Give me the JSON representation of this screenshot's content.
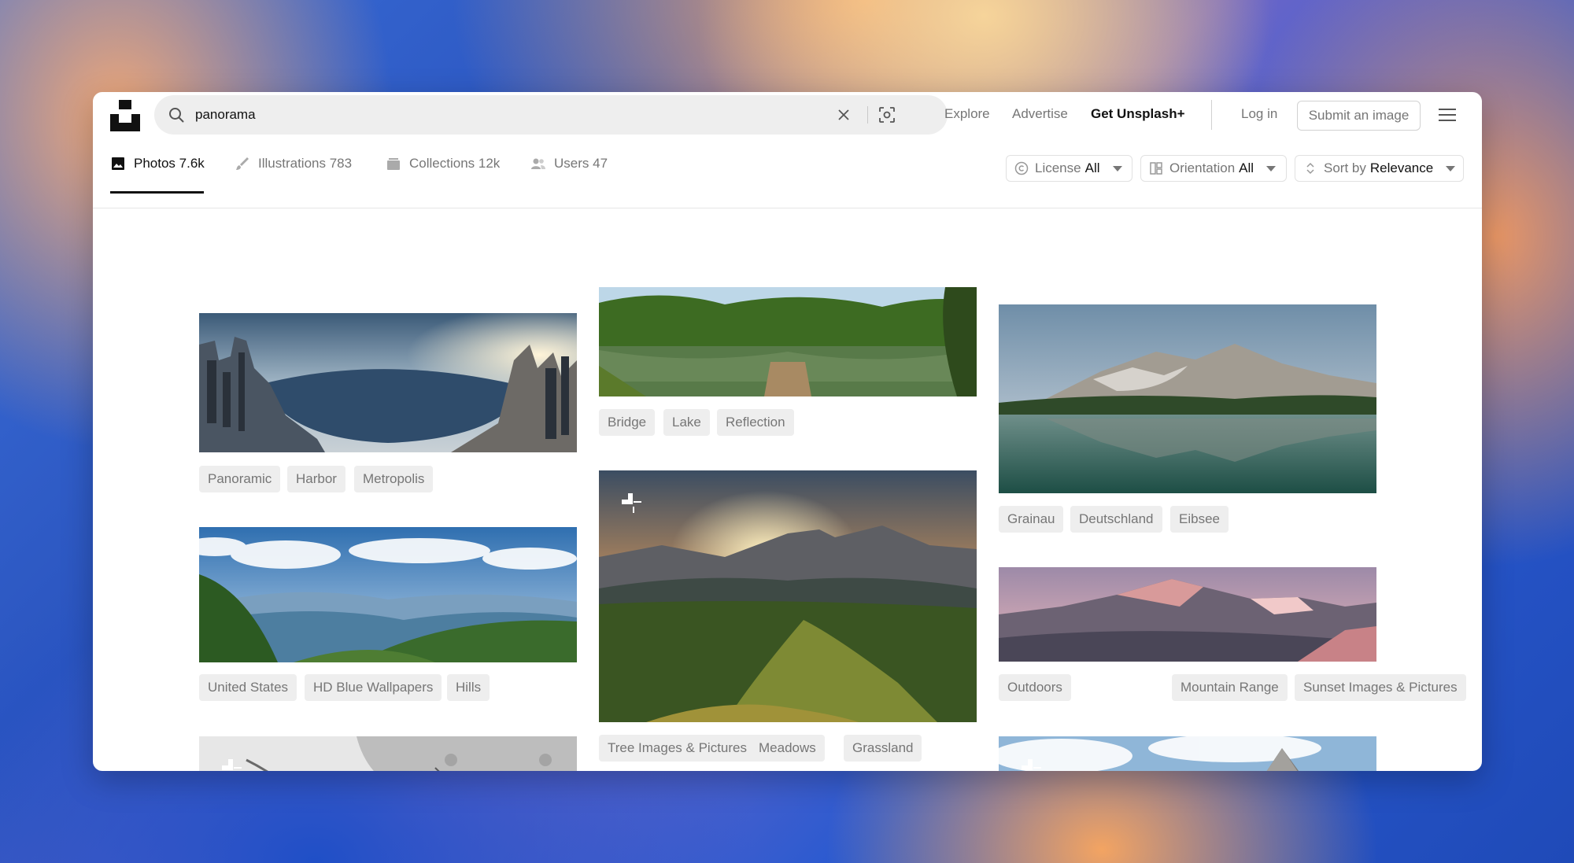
{
  "search": {
    "value": "panorama",
    "placeholder": "Search photos and illustrations"
  },
  "nav": {
    "explore": "Explore",
    "advertise": "Advertise",
    "get_plus": "Get Unsplash+",
    "login": "Log in",
    "submit": "Submit an image"
  },
  "tabs": [
    {
      "label": "Photos 7.6k",
      "icon": "photo-icon",
      "active": true
    },
    {
      "label": "Illustrations 783",
      "icon": "brush-icon"
    },
    {
      "label": "Collections 12k",
      "icon": "collections-icon"
    },
    {
      "label": "Users 47",
      "icon": "users-icon"
    }
  ],
  "filters": {
    "license": {
      "label": "License",
      "value": "All"
    },
    "orientation": {
      "label": "Orientation",
      "value": "All"
    },
    "sort": {
      "label": "Sort by",
      "value": "Relevance"
    }
  },
  "photos": {
    "hongkong": {
      "tags": [
        "Panoramic",
        "Harbor",
        "Metropolis"
      ]
    },
    "hills": {
      "tags": [
        "United States",
        "HD Blue Wallpapers",
        "Hills"
      ]
    },
    "lake": {
      "tags": [
        "Bridge",
        "Lake",
        "Reflection"
      ]
    },
    "sunset_ridge": {
      "tags": [
        "Tree Images & Pictures",
        "Meadows",
        "Grassland"
      ]
    },
    "eibsee": {
      "tags": [
        "Grainau",
        "Deutschland",
        "Eibsee"
      ]
    },
    "range": {
      "tags": [
        "Outdoors",
        "Mountain Range",
        "Sunset Images & Pictures"
      ]
    }
  },
  "colors": {
    "accent": "#111111",
    "tag_bg": "#eeeeee",
    "muted": "#767676"
  }
}
